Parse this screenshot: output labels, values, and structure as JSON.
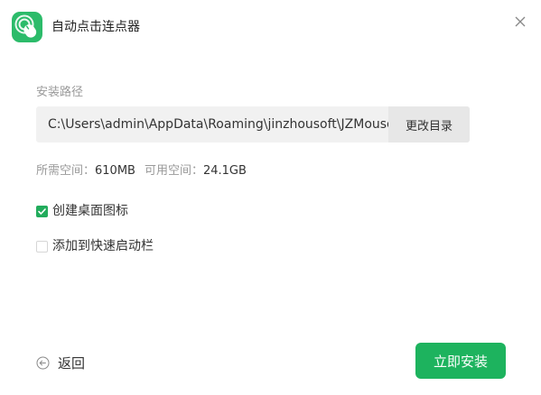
{
  "window": {
    "title": "自动点击连点器",
    "app_icon": "mouse-click-icon",
    "close_icon": "close-icon"
  },
  "install_path": {
    "label": "安装路径",
    "value": "C:\\Users\\admin\\AppData\\Roaming\\jinzhousoft\\JZMouse",
    "change_button": "更改目录"
  },
  "space": {
    "required_label": "所需空间：",
    "required_value": "610MB",
    "available_label": "可用空间：",
    "available_value": "24.1GB"
  },
  "options": [
    {
      "label": "创建桌面图标",
      "checked": true
    },
    {
      "label": "添加到快速启动栏",
      "checked": false
    }
  ],
  "footer": {
    "back_label": "返回",
    "back_icon": "back-arrow-icon",
    "install_label": "立即安装"
  },
  "colors": {
    "accent": "#1db35e",
    "checkbox": "#22ac5c"
  }
}
